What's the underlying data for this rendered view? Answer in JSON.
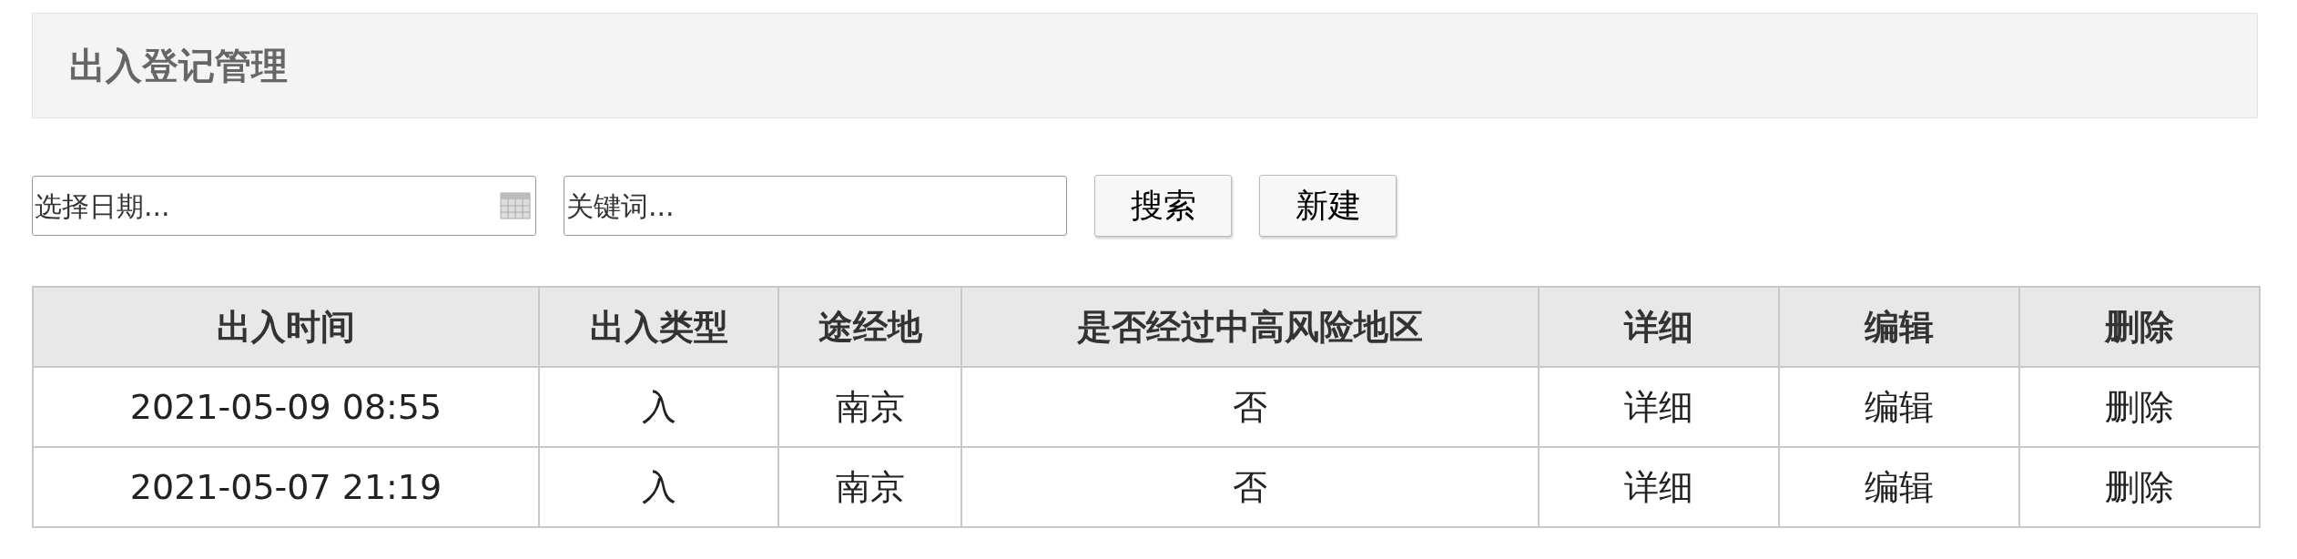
{
  "header": {
    "title": "出入登记管理"
  },
  "filters": {
    "date": {
      "placeholder": "选择日期..."
    },
    "keyword": {
      "placeholder": "关键词..."
    }
  },
  "buttons": [
    {
      "label": "搜索"
    },
    {
      "label": "新建"
    }
  ],
  "table": {
    "columns": [
      "出入时间",
      "出入类型",
      "途经地",
      "是否经过中高风险地区",
      "详细",
      "编辑",
      "删除"
    ],
    "rows": [
      {
        "cells": [
          "2021-05-09 08:55",
          "入",
          "南京",
          "否"
        ],
        "actions": [
          "详细",
          "编辑",
          "删除"
        ]
      },
      {
        "cells": [
          "2021-05-07 21:19",
          "入",
          "南京",
          "否"
        ],
        "actions": [
          "详细",
          "编辑",
          "删除"
        ]
      }
    ]
  }
}
